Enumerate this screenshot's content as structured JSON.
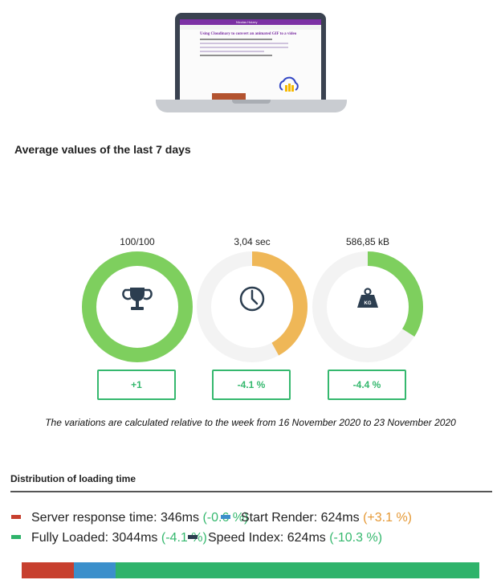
{
  "section_title": "Average values of the last 7 days",
  "preview": {
    "site_name": "Nicolas Hoizey",
    "article_title": "Using Cloudinary to convert an animated GIF to a video"
  },
  "metrics": [
    {
      "value": "100/100",
      "variation": "+1",
      "fill_fraction": 1.0,
      "color": "#7ecf5e",
      "icon": "trophy-icon"
    },
    {
      "value": "3,04 sec",
      "variation": "-4.1 %",
      "fill_fraction": 0.42,
      "color": "#efb757",
      "icon": "clock-icon"
    },
    {
      "value": "586,85 kB",
      "variation": "-4.4 %",
      "fill_fraction": 0.34,
      "color": "#7ecf5e",
      "icon": "weight-icon"
    }
  ],
  "variation_note": "The variations are calculated relative to the week from 16 November 2020 to 23 November 2020",
  "distribution": {
    "title": "Distribution of loading time",
    "legend": [
      {
        "label": "Server response time: 346ms",
        "delta": "(-0.6 %)",
        "color": "#c73f2e"
      },
      {
        "label": "Start Render: 624ms",
        "delta": "(+3.1 %)",
        "color": "#3b8fcb"
      },
      {
        "label": "Fully Loaded: 3044ms",
        "delta": "(-4.1 %)",
        "color": "#2fb36b"
      },
      {
        "label": "Speed Index: 624ms",
        "delta": "(-10.3 %)",
        "color": "#2c3e50"
      }
    ],
    "bar_segments": [
      {
        "value_ms": 346,
        "color": "#c73f2e"
      },
      {
        "value_ms": 278,
        "color": "#3b8fcb"
      },
      {
        "value_ms": 2420,
        "color": "#2fb36b"
      }
    ]
  },
  "colors": {
    "ring_track": "#f3f3f3",
    "positive_green": "#35b86e",
    "icon_dark": "#2c3e50"
  }
}
